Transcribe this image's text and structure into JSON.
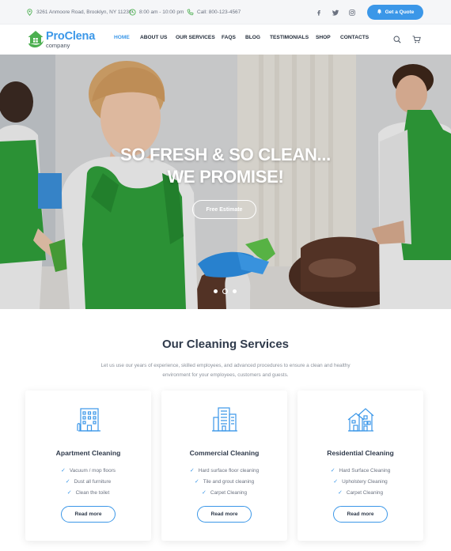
{
  "topbar": {
    "address": "3261 Anmoore Road, Brooklyn, NY 11230",
    "hours": "8:00 am - 10:00 pm",
    "phone": "Call: 800-123-4567",
    "social_icons": [
      "facebook-icon",
      "twitter-icon",
      "instagram-icon"
    ],
    "quote_label": "Get a Quote"
  },
  "brand": {
    "name": "ProClena",
    "tagline": "company"
  },
  "nav": {
    "items": [
      "HOME",
      "ABOUT US",
      "OUR SERVICES",
      "FAQS",
      "BLOG",
      "TESTIMONIALS",
      "SHOP",
      "CONTACTS"
    ],
    "active": "HOME"
  },
  "hero": {
    "line1": "SO FRESH & SO CLEAN...",
    "line2": "WE PROMISE!",
    "button": "Free Estimate",
    "slides": 3,
    "active_slide": 2
  },
  "services": {
    "title": "Our Cleaning Services",
    "intro": "Let us use our years of experience, skilled employees, and advanced procedures to ensure a clean and healthy environment for your employees, customers and guests.",
    "cards": [
      {
        "icon": "apartment-building-icon",
        "title": "Apartment Cleaning",
        "items": [
          "Vacuum / mop floors",
          "Dust all furniture",
          "Clean the toilet"
        ],
        "button": "Read more"
      },
      {
        "icon": "office-building-icon",
        "title": "Commercial Cleaning",
        "items": [
          "Hard surface floor cleaning",
          "Tile and grout cleaning",
          "Carpet Cleaning"
        ],
        "button": "Read more"
      },
      {
        "icon": "house-icon",
        "title": "Residential Cleaning",
        "items": [
          "Hard Surface Cleaning",
          "Upholstery Cleaning",
          "Carpet Cleaning"
        ],
        "button": "Read more"
      }
    ]
  },
  "colors": {
    "accent": "#3b97e8",
    "logo_green": "#4caf50",
    "topbar_bg": "#f5f6f8",
    "apron_green": "#2f9e3a"
  }
}
